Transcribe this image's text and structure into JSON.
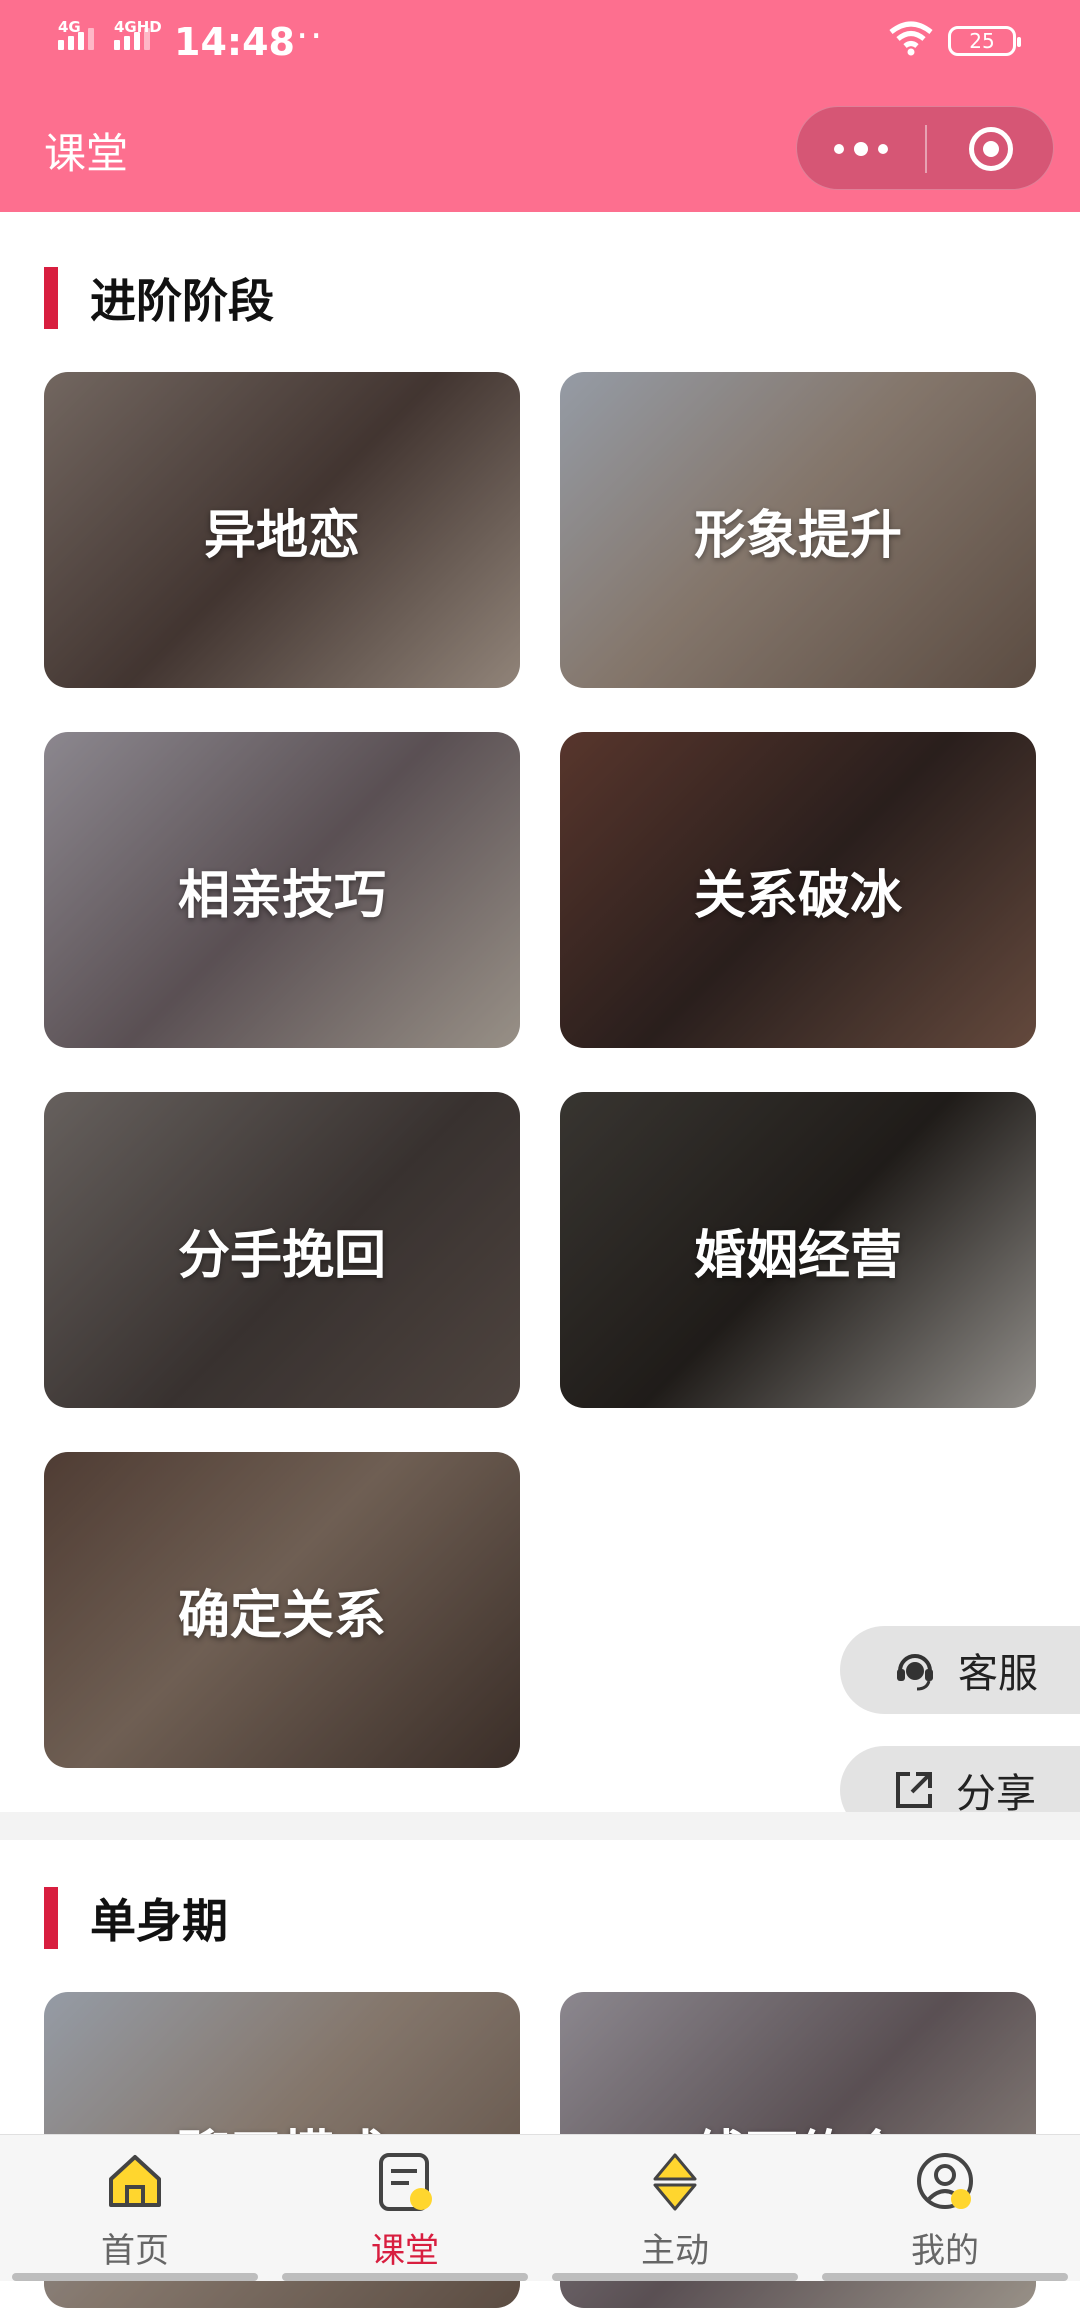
{
  "status_bar": {
    "time": "14:48",
    "more": "···",
    "sim1": "4G",
    "sim2": "4GHD",
    "battery": "25"
  },
  "header": {
    "title": "课堂",
    "menu_icon": "more-dots-icon",
    "close_icon": "target-icon"
  },
  "sections": [
    {
      "title": "进阶阶段",
      "cards": [
        "异地恋",
        "形象提升",
        "相亲技巧",
        "关系破冰",
        "分手挽回",
        "婚姻经营",
        "确定关系"
      ]
    },
    {
      "title": "单身期",
      "cards": [
        "聊天模式",
        "线下约会"
      ]
    }
  ],
  "floating": {
    "service": "客服",
    "share": "分享"
  },
  "tabbar": [
    {
      "label": "首页",
      "icon": "home-icon",
      "active": false
    },
    {
      "label": "课堂",
      "icon": "classroom-icon",
      "active": true
    },
    {
      "label": "主动",
      "icon": "active-icon",
      "active": false
    },
    {
      "label": "我的",
      "icon": "profile-icon",
      "active": false
    }
  ],
  "colors": {
    "header": "#fd6f8f",
    "accent": "#d81e3f",
    "tab_icon": "#ffd62e"
  }
}
